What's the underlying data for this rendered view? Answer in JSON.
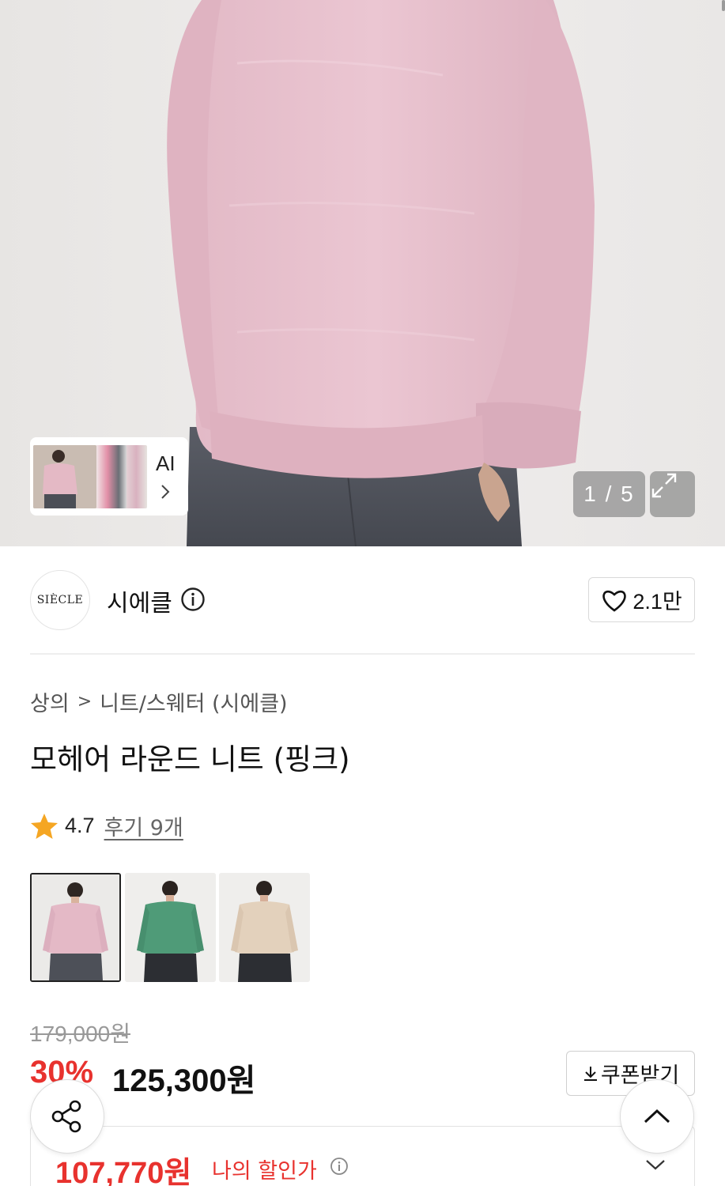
{
  "gallery": {
    "counter": "1 / 5",
    "ai_label": "AI",
    "expand_icon": "expand-icon",
    "ai_chevron_icon": "chevron-right-icon"
  },
  "brand": {
    "logo_text": "SIÈCLE",
    "name": "시에클",
    "info_icon": "info-icon",
    "like_icon": "heart-icon",
    "like_count": "2.1만"
  },
  "breadcrumb": {
    "category": "상의",
    "separator": ">",
    "subcategory": "니트/스웨터 (시에클)"
  },
  "product": {
    "title": "모헤어 라운드 니트 (핑크)",
    "rating": "4.7",
    "review_link": "후기 9개",
    "star_color": "#f5a623"
  },
  "colors": {
    "options": [
      {
        "name": "pink",
        "swatch": "#e6bccb",
        "selected": true
      },
      {
        "name": "green",
        "swatch": "#4f9b78",
        "selected": false
      },
      {
        "name": "beige",
        "swatch": "#e3d1bc",
        "selected": false
      }
    ]
  },
  "price": {
    "original": "179,000원",
    "discount": "30%",
    "sale": "125,300원",
    "coupon_label": "쿠폰받기",
    "coupon_icon": "download-icon",
    "my_price": "107,770원",
    "my_price_label": "나의 할인가",
    "accent": "#e8322e"
  },
  "floating": {
    "share_icon": "share-icon",
    "top_icon": "chevron-up-icon"
  }
}
